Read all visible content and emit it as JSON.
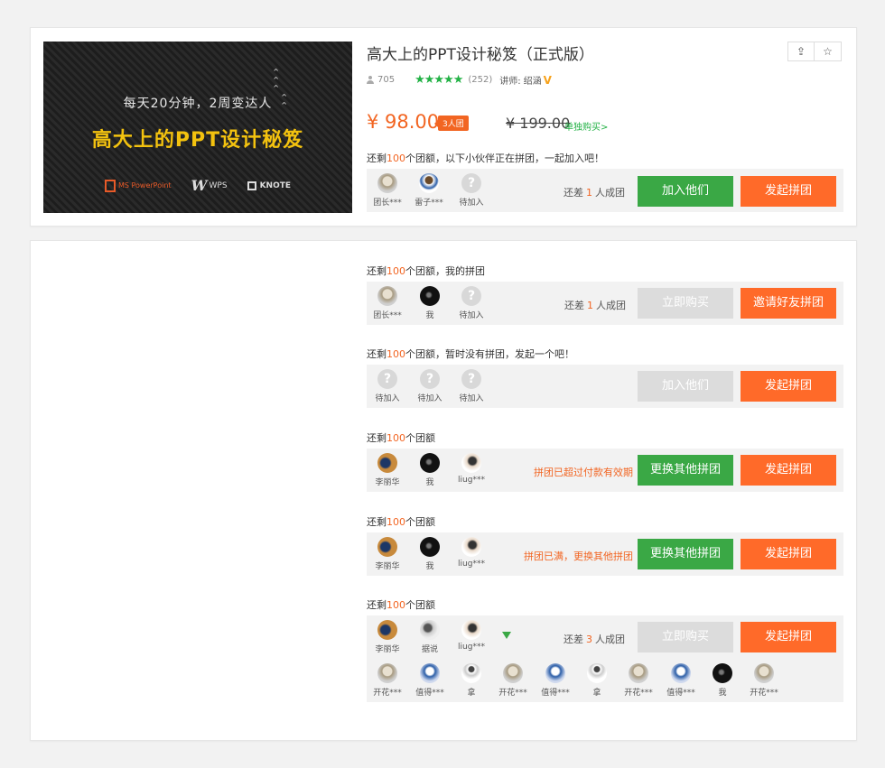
{
  "course": {
    "title": "高大上的PPT设计秘笈（正式版）",
    "students": "705",
    "stars": "★★★★★",
    "rating_count": "(252)",
    "teacher_label": "讲师:",
    "teacher_name": "绍涵",
    "price": "¥ 98.00",
    "group_tag": "3人团",
    "old_price": "¥ 199.00",
    "single_buy": "单独购买>"
  },
  "banner": {
    "subtitle": "每天20分钟，2周变达人",
    "headline": "高大上的PPT设计秘笈",
    "logos": [
      "MS PowerPoint",
      "WPS",
      "KNOTE"
    ]
  },
  "icons": {
    "share": "share-icon",
    "favorite": "star-icon"
  },
  "colors": {
    "accent": "#f26522",
    "green": "#3aa845",
    "orange": "#ff6a29",
    "disabled": "#dcdcdc"
  },
  "groups": [
    {
      "label_pre": "还剩",
      "label_num": "100",
      "label_post": "个团额，以下小伙伴正在拼团，一起加入吧！",
      "members": [
        "团长***",
        "雷子***",
        "待加入"
      ],
      "need_pre": "还差",
      "need_num": "1",
      "need_post": "人成团",
      "btn1": "加入他们",
      "btn2": "发起拼团"
    },
    {
      "label_pre": "还剩",
      "label_num": "100",
      "label_post": "个团额，我的拼团",
      "members": [
        "团长***",
        "我",
        "待加入"
      ],
      "need_pre": "还差",
      "need_num": "1",
      "need_post": "人成团",
      "btn1": "立即购买",
      "btn2": "邀请好友拼团"
    },
    {
      "label_pre": "还剩",
      "label_num": "100",
      "label_post": "个团额，暂时没有拼团，发起一个吧！",
      "members": [
        "待加入",
        "待加入",
        "待加入"
      ],
      "btn1": "加入他们",
      "btn2": "发起拼团"
    },
    {
      "label_pre": "还剩",
      "label_num": "100",
      "label_post": "个团额",
      "members": [
        "李丽华",
        "我",
        "liug***"
      ],
      "warning": "拼团已超过付款有效期",
      "btn1": "更换其他拼团",
      "btn2": "发起拼团"
    },
    {
      "label_pre": "还剩",
      "label_num": "100",
      "label_post": "个团额",
      "members": [
        "李丽华",
        "我",
        "liug***"
      ],
      "warning": "拼团已满，更换其他拼团",
      "btn1": "更换其他拼团",
      "btn2": "发起拼团"
    },
    {
      "label_pre": "还剩",
      "label_num": "100",
      "label_post": "个团额",
      "members": [
        "李丽华",
        "据说",
        "liug***"
      ],
      "need_pre": "还差",
      "need_num": "3",
      "need_post": "人成团",
      "btn1": "立即购买",
      "btn2": "发起拼团",
      "expanded_members": [
        "开花***",
        "值得***",
        "拿",
        "开花***",
        "值得***",
        "拿",
        "开花***",
        "值得***",
        "我",
        "开花***"
      ]
    }
  ]
}
